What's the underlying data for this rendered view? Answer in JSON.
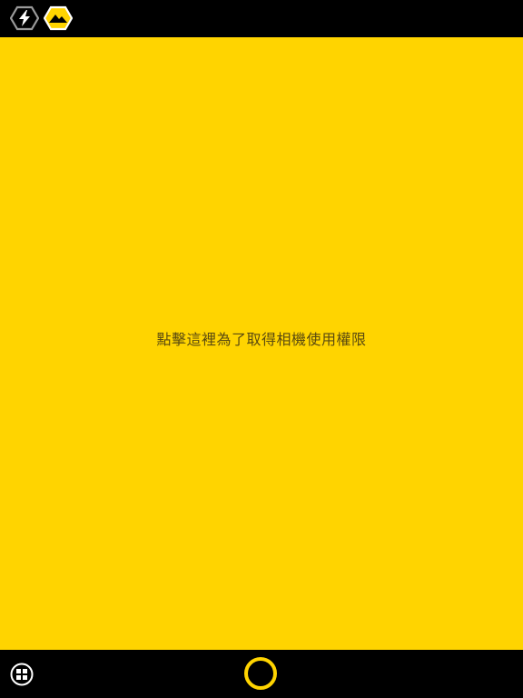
{
  "colors": {
    "accent": "#FFD400",
    "bar_background": "#000000",
    "message_text": "#5A4A10"
  },
  "top_bar": {
    "flash_icon": "lightning-hexagon-icon",
    "scene_icon": "mountain-hexagon-icon"
  },
  "preview": {
    "permission_message": "點擊這裡為了取得相機使用權限"
  },
  "bottom_bar": {
    "gallery_icon": "grid-circle-icon",
    "shutter_icon": "shutter-ring-icon"
  }
}
